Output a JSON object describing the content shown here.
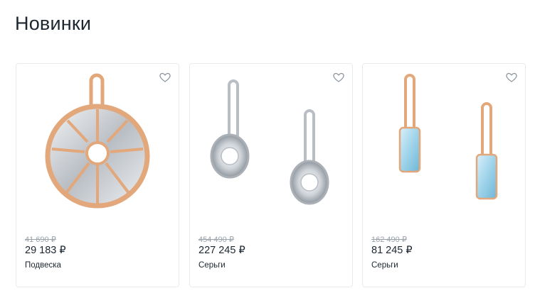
{
  "section": {
    "title": "Новинки"
  },
  "products": [
    {
      "old_price": "41 690 ₽",
      "price": "29 183 ₽",
      "category": "Подвеска",
      "image_icon": "pendant-image"
    },
    {
      "old_price": "454 490 ₽",
      "price": "227 245 ₽",
      "category": "Серьги",
      "image_icon": "earrings-image"
    },
    {
      "old_price": "162 490 ₽",
      "price": "81 245 ₽",
      "category": "Серьги",
      "image_icon": "earrings-image"
    }
  ],
  "colors": {
    "gold": "#e2a77a",
    "silver": "#c9ced3",
    "topaz": "#9fd3ea"
  }
}
